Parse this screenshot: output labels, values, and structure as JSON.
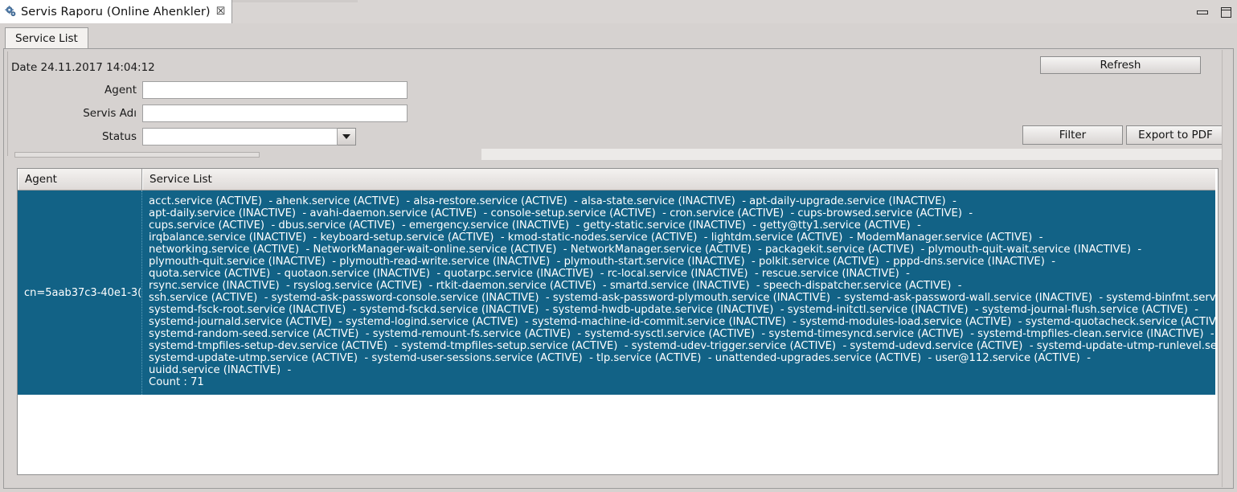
{
  "window": {
    "tab_title": "Servis Raporu (Online Ahenkler)",
    "tab_close_glyph": "☒",
    "app_icon": "gears-icon",
    "minimize_label": "",
    "maximize_label": ""
  },
  "tabs": [
    {
      "label": "Service List",
      "active": true
    }
  ],
  "form": {
    "date_label": "Date 24.11.2017 14:04:12",
    "fields": [
      {
        "label": "Agent",
        "value": "",
        "placeholder": ""
      },
      {
        "label": "Servis Adı",
        "value": "",
        "placeholder": ""
      }
    ],
    "status": {
      "label": "Status",
      "value": "",
      "options": []
    }
  },
  "buttons": {
    "refresh": "Refresh",
    "filter": "Filter",
    "export_pdf": "Export to PDF"
  },
  "table": {
    "columns": [
      "Agent",
      "Service List"
    ],
    "rows": [
      {
        "agent": "cn=5aab37c3-40e1-3(",
        "services_text": "acct.service (ACTIVE)  - ahenk.service (ACTIVE)  - alsa-restore.service (ACTIVE)  - alsa-state.service (INACTIVE)  - apt-daily-upgrade.service (INACTIVE)  -\napt-daily.service (INACTIVE)  - avahi-daemon.service (ACTIVE)  - console-setup.service (ACTIVE)  - cron.service (ACTIVE)  - cups-browsed.service (ACTIVE)  -\ncups.service (ACTIVE)  - dbus.service (ACTIVE)  - emergency.service (INACTIVE)  - getty-static.service (INACTIVE)  - getty@tty1.service (ACTIVE)  -\nirqbalance.service (INACTIVE)  - keyboard-setup.service (ACTIVE)  - kmod-static-nodes.service (ACTIVE)  - lightdm.service (ACTIVE)  - ModemManager.service (ACTIVE)  -\nnetworking.service (ACTIVE)  - NetworkManager-wait-online.service (ACTIVE)  - NetworkManager.service (ACTIVE)  - packagekit.service (ACTIVE)  - plymouth-quit-wait.service (INACTIVE)  -\nplymouth-quit.service (INACTIVE)  - plymouth-read-write.service (INACTIVE)  - plymouth-start.service (INACTIVE)  - polkit.service (ACTIVE)  - pppd-dns.service (INACTIVE)  -\nquota.service (ACTIVE)  - quotaon.service (INACTIVE)  - quotarpc.service (INACTIVE)  - rc-local.service (INACTIVE)  - rescue.service (INACTIVE)  -\nrsync.service (INACTIVE)  - rsyslog.service (ACTIVE)  - rtkit-daemon.service (ACTIVE)  - smartd.service (INACTIVE)  - speech-dispatcher.service (ACTIVE)  -\nssh.service (ACTIVE)  - systemd-ask-password-console.service (INACTIVE)  - systemd-ask-password-plymouth.service (INACTIVE)  - systemd-ask-password-wall.service (INACTIVE)  - systemd-binfmt.service\nsystemd-fsck-root.service (INACTIVE)  - systemd-fsckd.service (INACTIVE)  - systemd-hwdb-update.service (INACTIVE)  - systemd-initctl.service (INACTIVE)  - systemd-journal-flush.service (ACTIVE)  -\nsystemd-journald.service (ACTIVE)  - systemd-logind.service (ACTIVE)  - systemd-machine-id-commit.service (INACTIVE)  - systemd-modules-load.service (ACTIVE)  - systemd-quotacheck.service (ACTIVE)\nsystemd-random-seed.service (ACTIVE)  - systemd-remount-fs.service (ACTIVE)  - systemd-sysctl.service (ACTIVE)  - systemd-timesyncd.service (ACTIVE)  - systemd-tmpfiles-clean.service (INACTIVE)  -\nsystemd-tmpfiles-setup-dev.service (ACTIVE)  - systemd-tmpfiles-setup.service (ACTIVE)  - systemd-udev-trigger.service (ACTIVE)  - systemd-udevd.service (ACTIVE)  - systemd-update-utmp-runlevel.servic\nsystemd-update-utmp.service (ACTIVE)  - systemd-user-sessions.service (ACTIVE)  - tlp.service (ACTIVE)  - unattended-upgrades.service (ACTIVE)  - user@112.service (ACTIVE)  -\nuuidd.service (INACTIVE)  -\nCount : 71"
      }
    ]
  },
  "colors": {
    "selection_blue": "#126286",
    "panel_gray": "#d6d2d0",
    "tab_white": "#ffffff"
  }
}
